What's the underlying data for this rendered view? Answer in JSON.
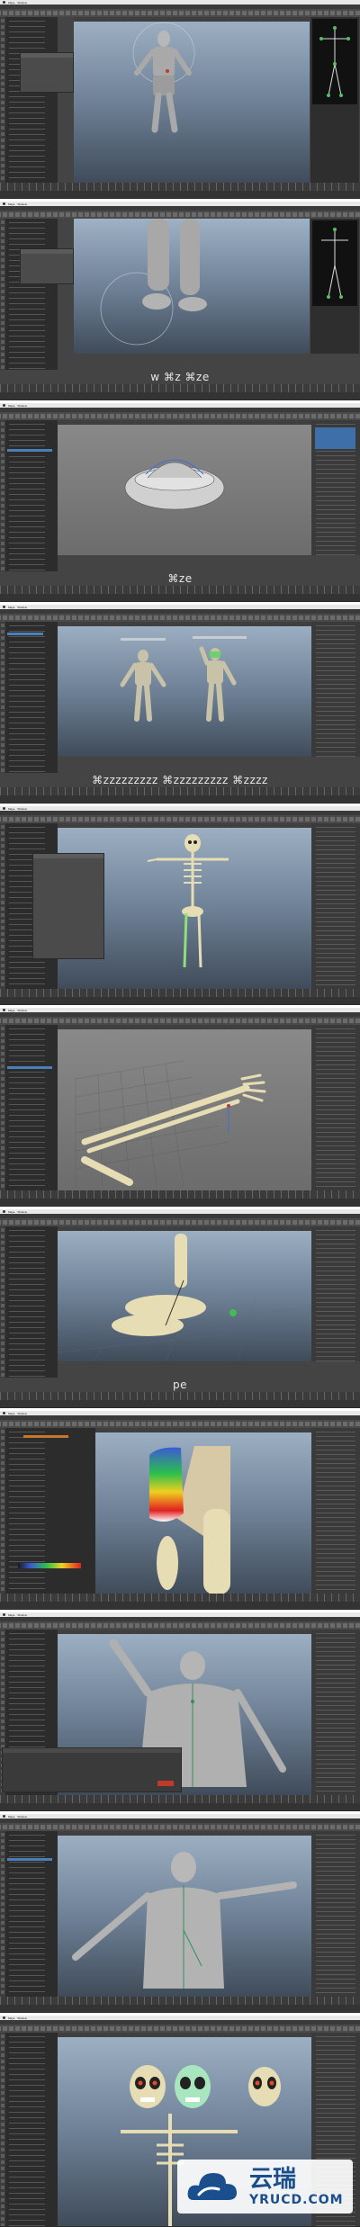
{
  "app": {
    "name": "Maya",
    "mac_menu": [
      "Maya",
      "Window"
    ]
  },
  "frames": [
    {
      "id": 1,
      "caption": ""
    },
    {
      "id": 2,
      "caption": "w ⌘z ⌘ze"
    },
    {
      "id": 3,
      "caption": "⌘ze"
    },
    {
      "id": 4,
      "caption": "⌘zzzzzzzzz ⌘zzzzzzzzz ⌘zzzz"
    },
    {
      "id": 5,
      "caption": ""
    },
    {
      "id": 6,
      "caption": ""
    },
    {
      "id": 7,
      "caption": "pe"
    },
    {
      "id": 8,
      "caption": ""
    },
    {
      "id": 9,
      "caption": ""
    },
    {
      "id": 10,
      "caption": ""
    },
    {
      "id": 11,
      "caption": ""
    }
  ],
  "watermark": {
    "cn": "云瑞",
    "en": "YRUCD.COM"
  },
  "colors": {
    "maya_bg": "#444444",
    "viewport_top": "#9fb1c5",
    "viewport_bottom": "#3f4b59",
    "highlight": "#4a7fb8",
    "watermark_blue": "#1a4e8c"
  }
}
